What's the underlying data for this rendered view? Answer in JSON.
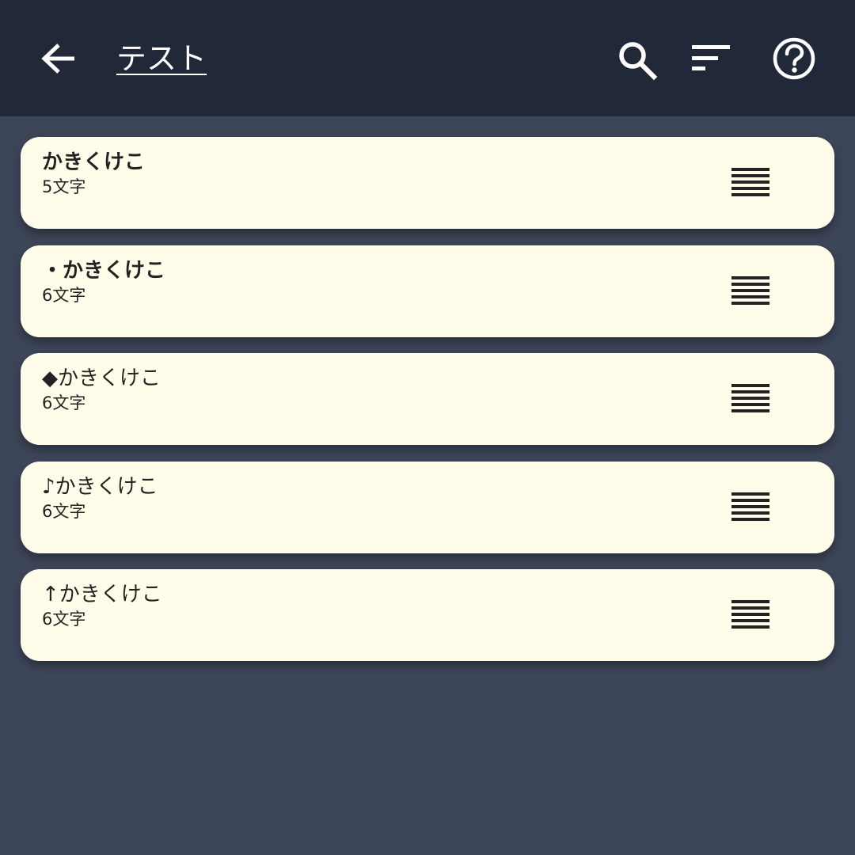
{
  "header": {
    "title": "テスト",
    "back_icon": "arrow-left-icon",
    "search_icon": "search-icon",
    "sort_icon": "sort-icon",
    "help_icon": "help-circle-icon"
  },
  "colors": {
    "appbar": "#212838",
    "background": "#3d4659",
    "card": "#fffde9",
    "text": "#222222"
  },
  "items": [
    {
      "name": "かきくけこ",
      "count": "5文字"
    },
    {
      "name": "・かきくけこ",
      "count": "6文字"
    },
    {
      "name": "◆かきくけこ",
      "count": "6文字"
    },
    {
      "name": "♪かきくけこ",
      "count": "6文字"
    },
    {
      "name": "↑かきくけこ",
      "count": "6文字"
    }
  ]
}
